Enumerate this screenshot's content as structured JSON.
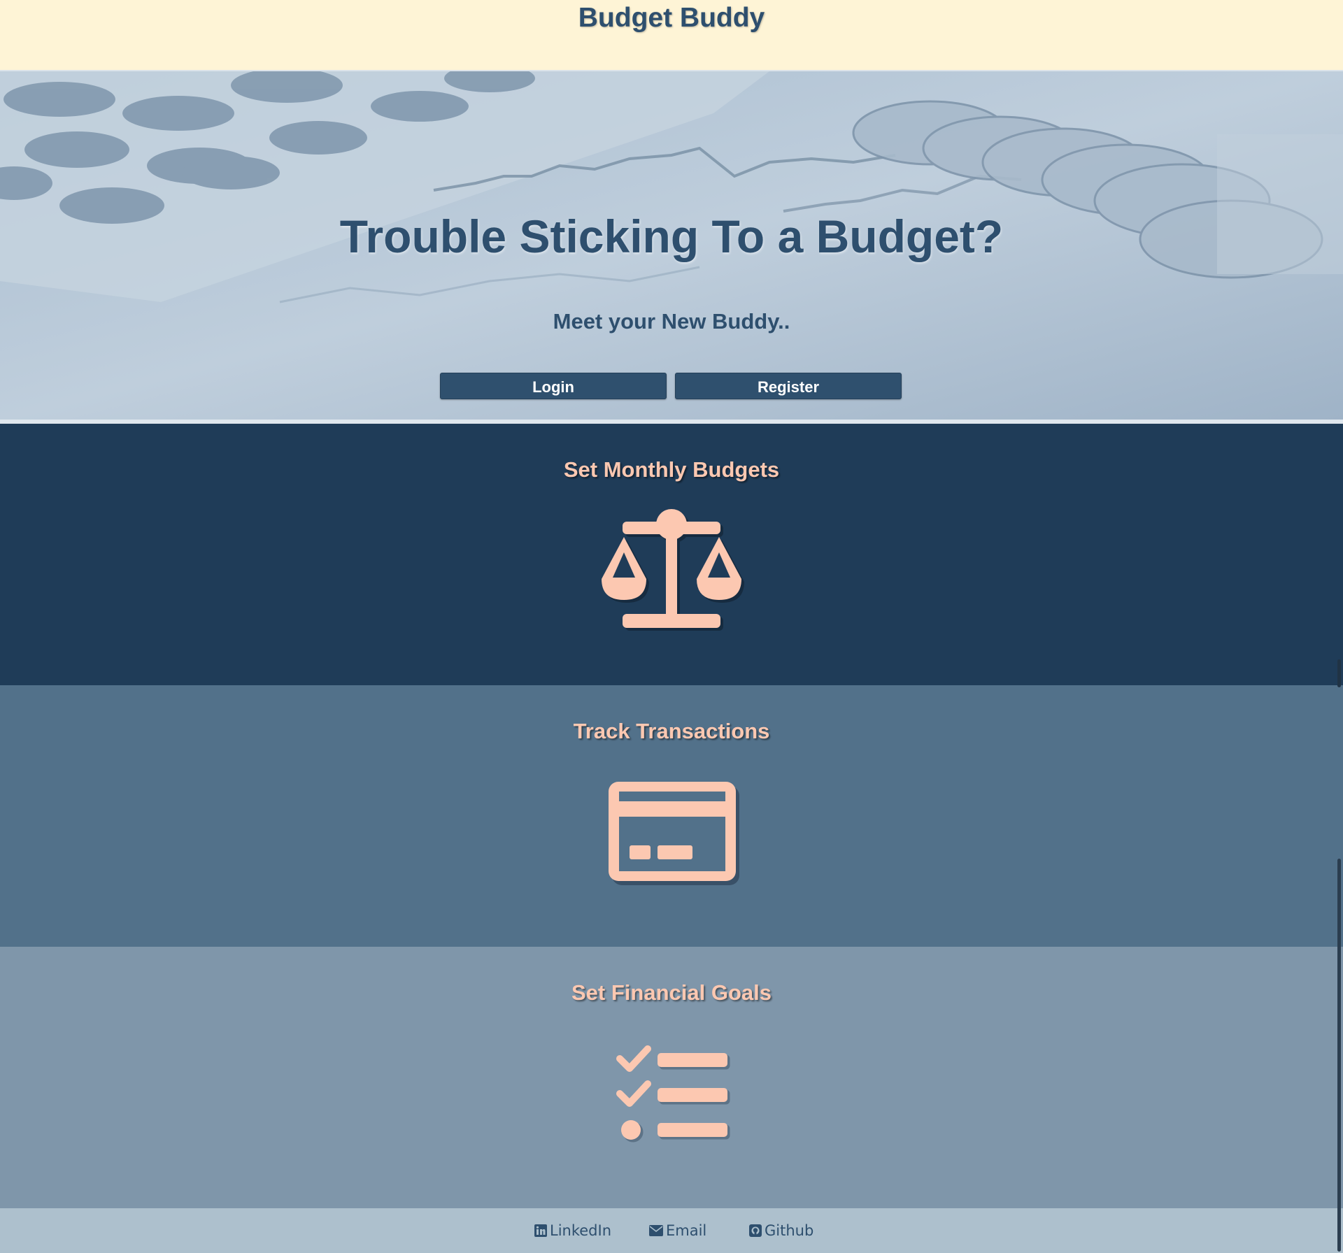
{
  "header": {
    "title": "Budget Buddy"
  },
  "hero": {
    "title": "Trouble Sticking To a Budget?",
    "subtitle": "Meet your New Buddy..",
    "login_label": "Login",
    "register_label": "Register"
  },
  "features": [
    {
      "title": "Set Monthly Budgets",
      "icon": "scale-balance-icon"
    },
    {
      "title": "Track Transactions",
      "icon": "credit-card-icon"
    },
    {
      "title": "Set Financial Goals",
      "icon": "checklist-icon"
    }
  ],
  "footer": {
    "links": [
      {
        "label": "LinkedIn",
        "icon": "linkedin-icon"
      },
      {
        "label": "Email",
        "icon": "envelope-icon"
      },
      {
        "label": "Github",
        "icon": "github-icon"
      }
    ]
  },
  "colors": {
    "header_bg": "#fef4d6",
    "primary_text": "#2e4f6e",
    "accent": "#fcc8b1",
    "button_bg": "#2f506e",
    "section1_bg": "#1f3c58",
    "section2_bg": "#52718a",
    "section3_bg": "#7f96aa",
    "footer_bg": "#adc0cd"
  }
}
